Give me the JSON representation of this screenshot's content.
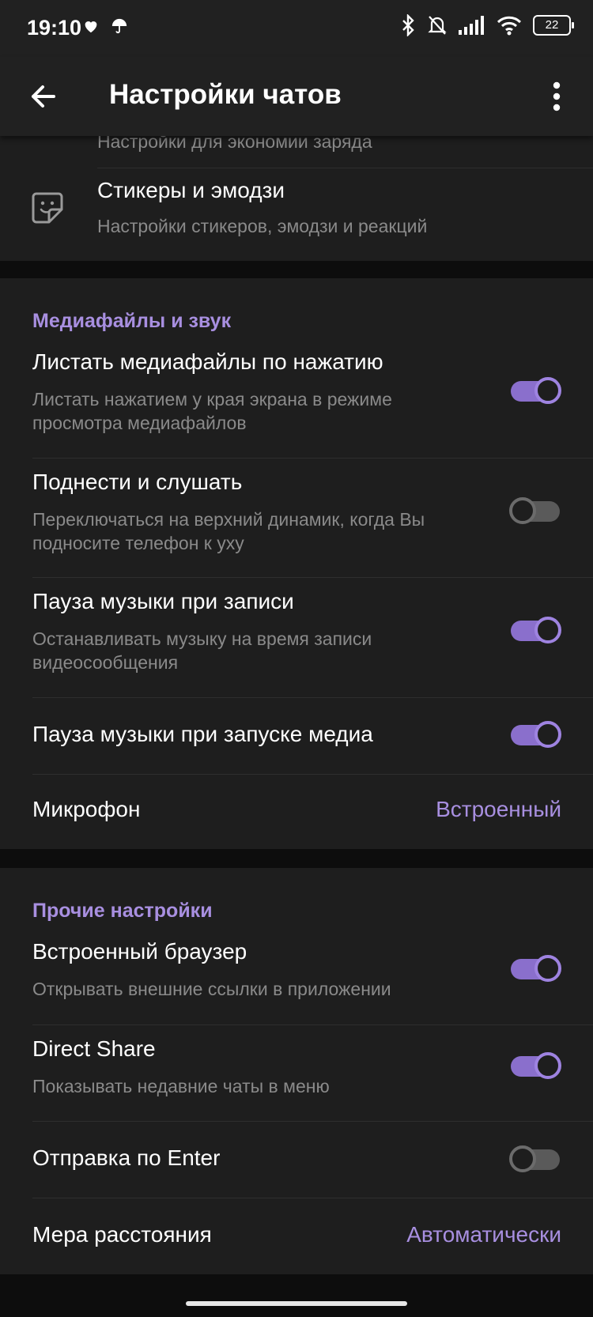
{
  "status_bar": {
    "time": "19:10",
    "battery": "22",
    "icons_left": [
      "heart-icon",
      "umbrella-icon"
    ],
    "icons_right": [
      "bluetooth-icon",
      "bell-off-icon",
      "signal-icon",
      "wifi-icon",
      "battery-icon"
    ]
  },
  "app_bar": {
    "title": "Настройки чатов",
    "back_icon": "arrow-left-icon",
    "menu_icon": "more-vertical-icon"
  },
  "top_card": {
    "partial_subtitle": "Настройки для экономии заряда",
    "stickers": {
      "title": "Стикеры и эмодзи",
      "subtitle": "Настройки стикеров, эмодзи и реакций",
      "icon": "sticker-icon"
    }
  },
  "media_section": {
    "header": "Медиафайлы и звук",
    "items": [
      {
        "title": "Листать медиафайлы по нажатию",
        "subtitle": "Листать нажатием у края экрана в режиме просмотра медиафайлов",
        "enabled": true
      },
      {
        "title": "Поднести и слушать",
        "subtitle": "Переключаться на верхний динамик, когда Вы подносите телефон к уху",
        "enabled": false
      },
      {
        "title": "Пауза музыки при записи",
        "subtitle": "Останавливать музыку на время записи видеосообщения",
        "enabled": true
      },
      {
        "title": "Пауза музыки при запуске медиа",
        "enabled": true
      }
    ],
    "microphone": {
      "label": "Микрофон",
      "value": "Встроенный"
    }
  },
  "other_section": {
    "header": "Прочие настройки",
    "items": [
      {
        "title": "Встроенный браузер",
        "subtitle": "Открывать внешние ссылки в приложении",
        "enabled": true
      },
      {
        "title": "Direct Share",
        "subtitle": "Показывать недавние чаты в меню",
        "enabled": true
      },
      {
        "title": "Отправка по Enter",
        "enabled": false
      }
    ],
    "distance": {
      "label": "Мера расстояния",
      "value": "Автоматически"
    }
  },
  "colors": {
    "accent": "#a88fe0",
    "toggle_on": "#8a6fcc",
    "background": "#0d0d0d",
    "card": "#1e1e1e",
    "secondary_text": "#8a8a8a"
  }
}
